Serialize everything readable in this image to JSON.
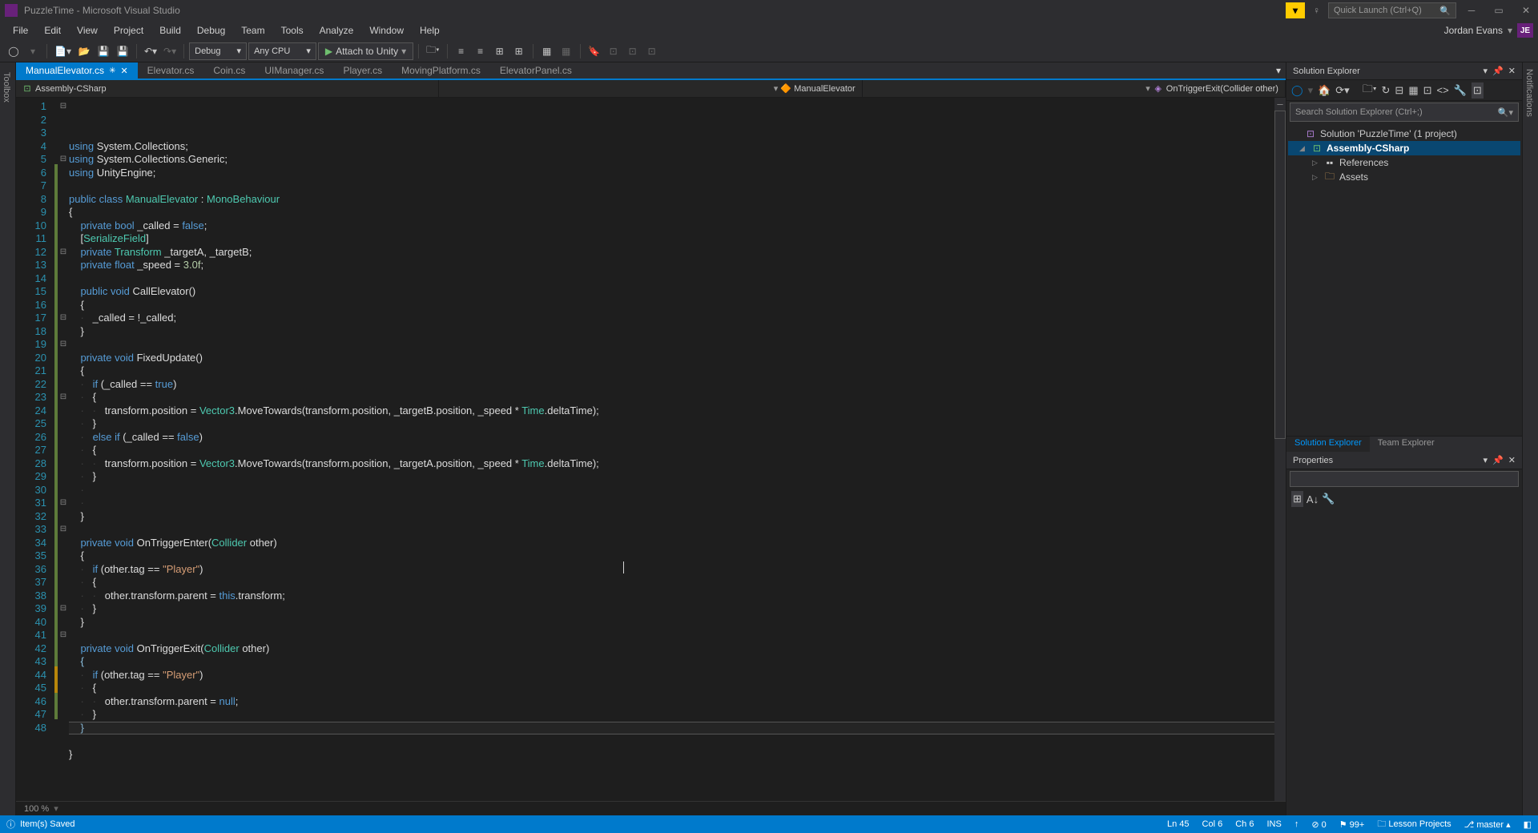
{
  "title": "PuzzleTime - Microsoft Visual Studio",
  "quickLaunch": {
    "placeholder": "Quick Launch (Ctrl+Q)"
  },
  "menu": [
    "File",
    "Edit",
    "View",
    "Project",
    "Build",
    "Debug",
    "Team",
    "Tools",
    "Analyze",
    "Window",
    "Help"
  ],
  "user": {
    "name": "Jordan Evans",
    "initials": "JE"
  },
  "toolbar": {
    "config": "Debug",
    "platform": "Any CPU",
    "run": "Attach to Unity"
  },
  "fileTabs": [
    {
      "label": "ManualElevator.cs",
      "active": true,
      "dirty": true
    },
    {
      "label": "Elevator.cs"
    },
    {
      "label": "Coin.cs"
    },
    {
      "label": "UIManager.cs"
    },
    {
      "label": "Player.cs"
    },
    {
      "label": "MovingPlatform.cs"
    },
    {
      "label": "ElevatorPanel.cs"
    }
  ],
  "context": {
    "project": "Assembly-CSharp",
    "class": "ManualElevator",
    "member": "OnTriggerExit(Collider other)"
  },
  "leftSideTabs": [
    "Toolbox"
  ],
  "rightSideTabs": [
    "Notifications"
  ],
  "zoom": "100 %",
  "solutionExplorer": {
    "title": "Solution Explorer",
    "searchPlaceholder": "Search Solution Explorer (Ctrl+;)",
    "nodes": {
      "solution": "Solution 'PuzzleTime' (1 project)",
      "project": "Assembly-CSharp",
      "refs": "References",
      "assets": "Assets"
    },
    "bottomTabs": [
      "Solution Explorer",
      "Team Explorer"
    ]
  },
  "properties": {
    "title": "Properties"
  },
  "status": {
    "left": "Item(s) Saved",
    "ln": "Ln 45",
    "col": "Col 6",
    "ch": "Ch 6",
    "ins": "INS",
    "errors": "0",
    "warnings": "99+",
    "repo": "Lesson Projects",
    "branch": "master",
    "publish": "",
    "arrowUp": "↑"
  },
  "code": {
    "lines": [
      {
        "n": 1,
        "f": "⊟",
        "i": "",
        "html": "<span class='kw'>using</span> System.Collections;"
      },
      {
        "n": 2,
        "i": "",
        "html": "<span class='kw'>using</span> System.Collections.Generic;"
      },
      {
        "n": 3,
        "i": "",
        "html": "<span class='kw'>using</span> UnityEngine;"
      },
      {
        "n": 4,
        "i": "",
        "html": ""
      },
      {
        "n": 5,
        "f": "⊟",
        "i": "",
        "html": "<span class='kw'>public</span> <span class='kw'>class</span> <span class='cls'>ManualElevator</span> : <span class='cls'>MonoBehaviour</span>"
      },
      {
        "n": 6,
        "i": "",
        "html": "{",
        "ch": "g"
      },
      {
        "n": 7,
        "i": "    ",
        "html": "<span class='kw'>private</span> <span class='kw'>bool</span> _called = <span class='kw'>false</span>;",
        "ch": "g"
      },
      {
        "n": 8,
        "i": "    ",
        "html": "[<span class='cls'>SerializeField</span>]",
        "ch": "g"
      },
      {
        "n": 9,
        "i": "    ",
        "html": "<span class='kw'>private</span> <span class='cls'>Transform</span> _targetA, _targetB;",
        "ch": "g"
      },
      {
        "n": 10,
        "i": "    ",
        "html": "<span class='kw'>private</span> <span class='kw'>float</span> _speed = <span class='num'>3.0f</span>;",
        "ch": "g"
      },
      {
        "n": 11,
        "i": "",
        "html": "",
        "ch": "g"
      },
      {
        "n": 12,
        "f": "⊟",
        "i": "    ",
        "html": "<span class='kw'>public</span> <span class='kw'>void</span> CallElevator()",
        "ch": "g"
      },
      {
        "n": 13,
        "i": "    ",
        "html": "{",
        "ch": "g"
      },
      {
        "n": 14,
        "i": "    <span class='guide'>·   </span>",
        "html": "_called = !_called;",
        "ch": "g"
      },
      {
        "n": 15,
        "i": "    ",
        "html": "}",
        "ch": "g"
      },
      {
        "n": 16,
        "i": "",
        "html": "",
        "ch": "g"
      },
      {
        "n": 17,
        "f": "⊟",
        "i": "    ",
        "html": "<span class='kw'>private</span> <span class='kw'>void</span> FixedUpdate()",
        "ch": "g"
      },
      {
        "n": 18,
        "i": "    ",
        "html": "{",
        "ch": "g"
      },
      {
        "n": 19,
        "f": "⊟",
        "i": "    <span class='guide'>·   </span>",
        "html": "<span class='kw'>if</span> (_called == <span class='kw'>true</span>)",
        "ch": "g"
      },
      {
        "n": 20,
        "i": "    <span class='guide'>·   </span>",
        "html": "{",
        "ch": "g"
      },
      {
        "n": 21,
        "i": "    <span class='guide'>·   ·   </span>",
        "html": "transform.position = <span class='cls'>Vector3</span>.MoveTowards(transform.position, _targetB.position, _speed * <span class='cls'>Time</span>.deltaTime);",
        "ch": "g"
      },
      {
        "n": 22,
        "i": "    <span class='guide'>·   </span>",
        "html": "}",
        "ch": "g"
      },
      {
        "n": 23,
        "f": "⊟",
        "i": "    <span class='guide'>·   </span>",
        "html": "<span class='kw'>else</span> <span class='kw'>if</span> (_called == <span class='kw'>false</span>)",
        "ch": "g"
      },
      {
        "n": 24,
        "i": "    <span class='guide'>·   </span>",
        "html": "{",
        "ch": "g"
      },
      {
        "n": 25,
        "i": "    <span class='guide'>·   ·   </span>",
        "html": "transform.position = <span class='cls'>Vector3</span>.MoveTowards(transform.position, _targetA.position, _speed * <span class='cls'>Time</span>.deltaTime);",
        "ch": "g"
      },
      {
        "n": 26,
        "i": "    <span class='guide'>·   </span>",
        "html": "}",
        "ch": "g"
      },
      {
        "n": 27,
        "i": "    <span class='guide'>·   </span>",
        "html": "",
        "ch": "g"
      },
      {
        "n": 28,
        "i": "    <span class='guide'>·   </span>",
        "html": "",
        "ch": "g"
      },
      {
        "n": 29,
        "i": "    ",
        "html": "}",
        "ch": "g"
      },
      {
        "n": 30,
        "i": "",
        "html": "",
        "ch": "g"
      },
      {
        "n": 31,
        "f": "⊟",
        "i": "    ",
        "html": "<span class='kw'>private</span> <span class='kw'>void</span> OnTriggerEnter(<span class='cls'>Collider</span> other)",
        "ch": "g"
      },
      {
        "n": 32,
        "i": "    ",
        "html": "{",
        "ch": "g"
      },
      {
        "n": 33,
        "f": "⊟",
        "i": "    <span class='guide'>·   </span>",
        "html": "<span class='kw'>if</span> (other.tag == <span class='str'>\"Player\"</span>)",
        "ch": "g"
      },
      {
        "n": 34,
        "i": "    <span class='guide'>·   </span>",
        "html": "{",
        "ch": "g"
      },
      {
        "n": 35,
        "i": "    <span class='guide'>·   ·   </span>",
        "html": "other.transform.parent = <span class='kw'>this</span>.transform;",
        "ch": "g"
      },
      {
        "n": 36,
        "i": "    <span class='guide'>·   </span>",
        "html": "}",
        "ch": "g"
      },
      {
        "n": 37,
        "i": "    ",
        "html": "}",
        "ch": "g"
      },
      {
        "n": 38,
        "i": "",
        "html": "",
        "ch": "g"
      },
      {
        "n": 39,
        "f": "⊟",
        "i": "    ",
        "html": "<span class='kw'>private</span> <span class='kw'>void</span> OnTriggerExit(<span class='cls'>Collider</span> other)",
        "ch": "g"
      },
      {
        "n": 40,
        "i": "    ",
        "html": "<span style='color:#8fc5e6'>{</span>",
        "ch": "g"
      },
      {
        "n": 41,
        "f": "⊟",
        "i": "    <span class='guide'>·   </span>",
        "html": "<span class='kw'>if</span> (other.tag == <span class='str'>\"Player\"</span>)",
        "ch": "g"
      },
      {
        "n": 42,
        "i": "    <span class='guide'>·   </span>",
        "html": "{",
        "ch": "g"
      },
      {
        "n": 43,
        "i": "    <span class='guide'>·   ·   </span>",
        "html": "other.transform.parent = <span class='kw'>null</span>;",
        "ch": "g"
      },
      {
        "n": 44,
        "i": "    <span class='guide'>·   </span>",
        "html": "}",
        "ch": "y"
      },
      {
        "n": 45,
        "i": "    ",
        "html": "<span style='color:#8fc5e6'>}</span>",
        "ch": "y",
        "hl": true
      },
      {
        "n": 46,
        "i": "",
        "html": "",
        "ch": "g"
      },
      {
        "n": 47,
        "i": "",
        "html": "}",
        "ch": "g"
      },
      {
        "n": 48,
        "i": "",
        "html": ""
      }
    ]
  }
}
